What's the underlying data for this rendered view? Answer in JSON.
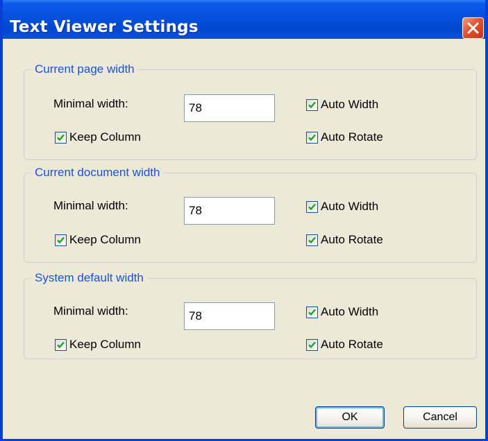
{
  "window": {
    "title": "Text Viewer Settings",
    "close_icon": "close-icon"
  },
  "groups": [
    {
      "title": "Current page width",
      "minimal_width_label": "Minimal width:",
      "minimal_width_value": "78",
      "auto_width_label": "Auto Width",
      "auto_width_checked": true,
      "keep_column_label": "Keep Column",
      "keep_column_checked": true,
      "auto_rotate_label": "Auto Rotate",
      "auto_rotate_checked": true
    },
    {
      "title": "Current document width",
      "minimal_width_label": "Minimal width:",
      "minimal_width_value": "78",
      "auto_width_label": "Auto Width",
      "auto_width_checked": true,
      "keep_column_label": "Keep Column",
      "keep_column_checked": true,
      "auto_rotate_label": "Auto Rotate",
      "auto_rotate_checked": true
    },
    {
      "title": "System default width",
      "minimal_width_label": "Minimal width:",
      "minimal_width_value": "78",
      "auto_width_label": "Auto Width",
      "auto_width_checked": true,
      "keep_column_label": "Keep Column",
      "keep_column_checked": true,
      "auto_rotate_label": "Auto Rotate",
      "auto_rotate_checked": true
    }
  ],
  "buttons": {
    "ok_label": "OK",
    "cancel_label": "Cancel"
  },
  "colors": {
    "titlebar": "#0550dc",
    "window_frame": "#0a3fd6",
    "dialog_background": "#ece9d8",
    "group_title": "#1a52d6",
    "close_button": "#e0532c",
    "checkmark": "#21a121"
  }
}
